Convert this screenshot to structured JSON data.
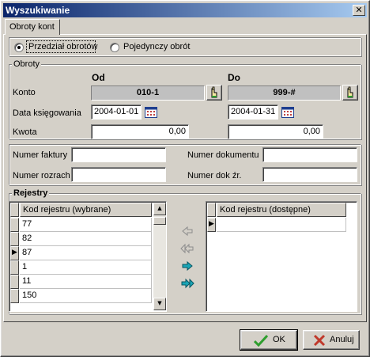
{
  "window": {
    "title": "Wyszukiwanie",
    "close_glyph": "✕"
  },
  "tabs": [
    {
      "label": "Obroty kont",
      "active": true
    }
  ],
  "mode": {
    "options": [
      {
        "label": "Przedział obrotów",
        "selected": true
      },
      {
        "label": "Pojedynczy obrót",
        "selected": false
      }
    ]
  },
  "obroty": {
    "legend": "Obroty",
    "from_header": "Od",
    "to_header": "Do",
    "konto_label": "Konto",
    "konto_from": "010-1",
    "konto_to": "999-#",
    "data_label": "Data księgowania",
    "data_from": "2004-01-01",
    "data_to": "2004-01-31",
    "kwota_label": "Kwota",
    "kwota_from": "0,00",
    "kwota_to": "0,00",
    "icons": {
      "account_picker": "hand-pointer-icon",
      "date_picker": "calendar-icon"
    }
  },
  "docs": {
    "numer_faktury_label": "Numer faktury",
    "numer_faktury": "",
    "numer_rozrach_label": "Numer rozrach",
    "numer_rozrach": "",
    "numer_dokumentu_label": "Numer dokumentu",
    "numer_dokumentu": "",
    "numer_dok_zr_label": "Numer dok źr.",
    "numer_dok_zr": ""
  },
  "rejestry": {
    "legend": "Rejestry",
    "selected_header": "Kod rejestru (wybrane)",
    "selected_rows": [
      "77",
      "82",
      "87",
      "1",
      "11",
      "150"
    ],
    "current_selected_row": 2,
    "available_header": "Kod rejestru (dostępne)",
    "available_rows": [
      ""
    ],
    "transfer_icons": [
      "move-left-icon",
      "move-all-left-icon",
      "move-right-icon",
      "move-all-right-icon"
    ]
  },
  "buttons": {
    "ok": "OK",
    "cancel": "Anuluj"
  },
  "colors": {
    "title_start": "#0a246a",
    "title_end": "#a6caf0",
    "face": "#d4d0c8",
    "ok_check": "#2e9e2e",
    "cancel_x": "#c0392b",
    "arrow_active": "#1aa6b7"
  }
}
